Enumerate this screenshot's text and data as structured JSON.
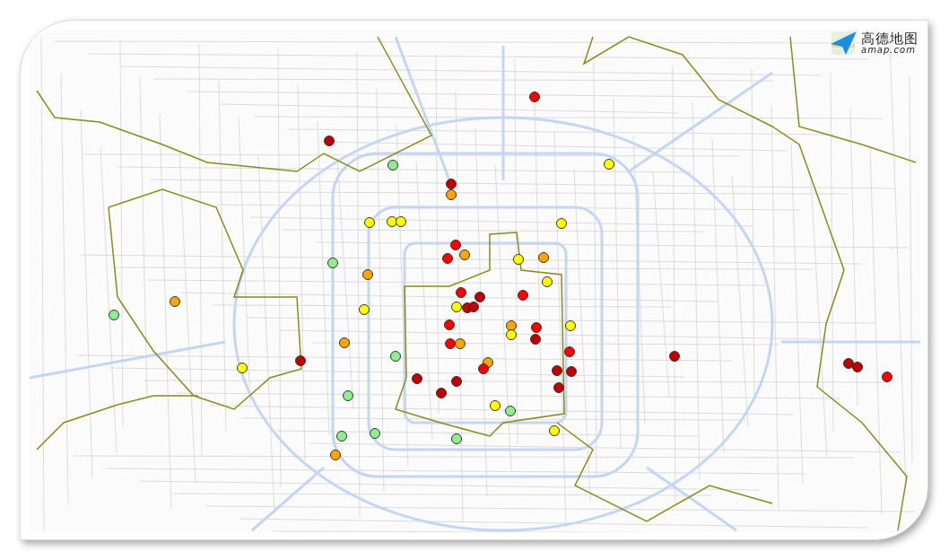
{
  "logo": {
    "name": "高德地图",
    "domain": "amap.com"
  },
  "markers": [
    {
      "color": "#ff0000"
    },
    {
      "color": "#c00000"
    },
    {
      "color": "#ffff00"
    },
    {
      "color": "#90ee90"
    },
    {
      "color": "#c00000"
    },
    {
      "color": "#ffa500"
    },
    {
      "color": "#ffff00"
    },
    {
      "color": "#ffff00"
    },
    {
      "color": "#ffff00"
    },
    {
      "color": "#ffff00"
    },
    {
      "color": "#ff0000"
    },
    {
      "color": "#ffa500"
    },
    {
      "color": "#ffa500"
    },
    {
      "color": "#ff0000"
    },
    {
      "color": "#ffff00"
    },
    {
      "color": "#90ee90"
    },
    {
      "color": "#ffa500"
    },
    {
      "color": "#ffff00"
    },
    {
      "color": "#ff0000"
    },
    {
      "color": "#ff0000"
    },
    {
      "color": "#c00000"
    },
    {
      "color": "#ffa500"
    },
    {
      "color": "#ffff00"
    },
    {
      "color": "#c00000"
    },
    {
      "color": "#c00000"
    },
    {
      "color": "#ffff00"
    },
    {
      "color": "#90ee90"
    },
    {
      "color": "#ff0000"
    },
    {
      "color": "#ffa500"
    },
    {
      "color": "#ffff00"
    },
    {
      "color": "#ff0000"
    },
    {
      "color": "#ffff00"
    },
    {
      "color": "#c00000"
    },
    {
      "color": "#ffa500"
    },
    {
      "color": "#ff0000"
    },
    {
      "color": "#ffa500"
    },
    {
      "color": "#ff0000"
    },
    {
      "color": "#90ee90"
    },
    {
      "color": "#c00000"
    },
    {
      "color": "#c00000"
    },
    {
      "color": "#ffa500"
    },
    {
      "color": "#c00000"
    },
    {
      "color": "#c00000"
    },
    {
      "color": "#ffff00"
    },
    {
      "color": "#ff0000"
    },
    {
      "color": "#c00000"
    },
    {
      "color": "#c00000"
    },
    {
      "color": "#ff0000"
    },
    {
      "color": "#c00000"
    },
    {
      "color": "#c00000"
    },
    {
      "color": "#c00000"
    },
    {
      "color": "#c00000"
    },
    {
      "color": "#90ee90"
    },
    {
      "color": "#ffff00"
    },
    {
      "color": "#90ee90"
    },
    {
      "color": "#ffff00"
    },
    {
      "color": "#90ee90"
    },
    {
      "color": "#90ee90"
    },
    {
      "color": "#90ee90"
    },
    {
      "color": "#ffa500"
    }
  ]
}
